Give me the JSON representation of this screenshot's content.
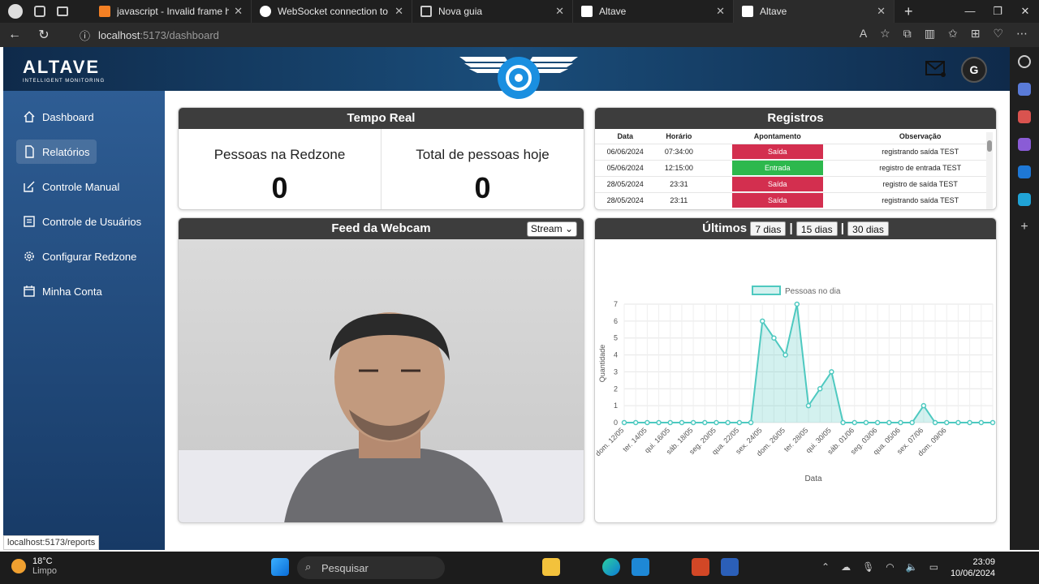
{
  "browser": {
    "tabs": [
      {
        "title": "javascript - Invalid frame header",
        "icon_color": "#f48024"
      },
      {
        "title": "WebSocket connection to failed:",
        "icon_color": "#ffffff"
      },
      {
        "title": "Nova guia",
        "icon_color": "#cccccc"
      },
      {
        "title": "Altave",
        "icon_color": "#1a4d7a"
      },
      {
        "title": "Altave",
        "icon_color": "#1a4d7a"
      }
    ],
    "url_host": "localhost",
    "url_path": ":5173/dashboard",
    "status_url": "localhost:5173/reports"
  },
  "brand": {
    "name": "ALTAVE",
    "tagline": "INTELLIGENT MONITORING",
    "avatar_letter": "G"
  },
  "sidebar": {
    "items": [
      {
        "label": "Dashboard",
        "icon": "home-icon"
      },
      {
        "label": "Relatórios",
        "icon": "document-icon"
      },
      {
        "label": "Controle Manual",
        "icon": "edit-icon"
      },
      {
        "label": "Controle de Usuários",
        "icon": "users-list-icon"
      },
      {
        "label": "Configurar Redzone",
        "icon": "gear-icon"
      },
      {
        "label": "Minha Conta",
        "icon": "calendar-icon"
      }
    ]
  },
  "realtime": {
    "title": "Tempo Real",
    "left_label": "Pessoas na Redzone",
    "left_value": "0",
    "right_label": "Total de pessoas hoje",
    "right_value": "0"
  },
  "records": {
    "title": "Registros",
    "headers": [
      "Data",
      "Horário",
      "Apontamento",
      "Observação"
    ],
    "rows": [
      {
        "date": "06/06/2024",
        "time": "07:34:00",
        "type": "Saída",
        "note": "registrando saída TEST"
      },
      {
        "date": "05/06/2024",
        "time": "12:15:00",
        "type": "Entrada",
        "note": "registro de entrada TEST"
      },
      {
        "date": "28/05/2024",
        "time": "23:31",
        "type": "Saída",
        "note": "registro de saída TEST"
      },
      {
        "date": "28/05/2024",
        "time": "23:11",
        "type": "Saída",
        "note": "registrando saída TEST"
      }
    ],
    "colors": {
      "exit": "#d32f4f",
      "entry": "#2db84d"
    }
  },
  "webcam": {
    "title": "Feed da Webcam",
    "mode": "Stream"
  },
  "last": {
    "title": "Últimos",
    "btn7": "7 dias",
    "sep": "|",
    "btn15": "15 dias",
    "btn30": "30 dias"
  },
  "chart_data": {
    "type": "area",
    "xlabel": "Data",
    "ylabel": "Quantidade",
    "legend": "Pessoas no dia",
    "legend_position": "top",
    "ylim": [
      0,
      7
    ],
    "yticks": [
      0,
      1,
      2,
      3,
      4,
      5,
      6,
      7
    ],
    "tick_labels": [
      "dom. 12/05",
      "ter. 14/05",
      "qui. 16/05",
      "sáb. 18/05",
      "seg. 20/05",
      "qua. 22/05",
      "sex. 24/05",
      "dom. 26/05",
      "ter. 28/05",
      "qui. 30/05",
      "sáb. 01/06",
      "seg. 03/06",
      "qua. 05/06",
      "sex. 07/06",
      "dom. 09/06"
    ],
    "values": [
      0,
      0,
      0,
      0,
      0,
      0,
      0,
      0,
      0,
      0,
      0,
      0,
      6,
      5,
      4,
      7,
      1,
      2,
      3,
      0,
      0,
      0,
      0,
      0,
      0,
      0,
      1,
      0,
      0,
      0,
      0,
      0,
      0
    ],
    "color": "#4ec9c0",
    "grid": true
  },
  "taskbar": {
    "temp": "18°C",
    "weather": "Limpo",
    "search": "Pesquisar",
    "time": "23:09",
    "date": "10/06/2024"
  }
}
